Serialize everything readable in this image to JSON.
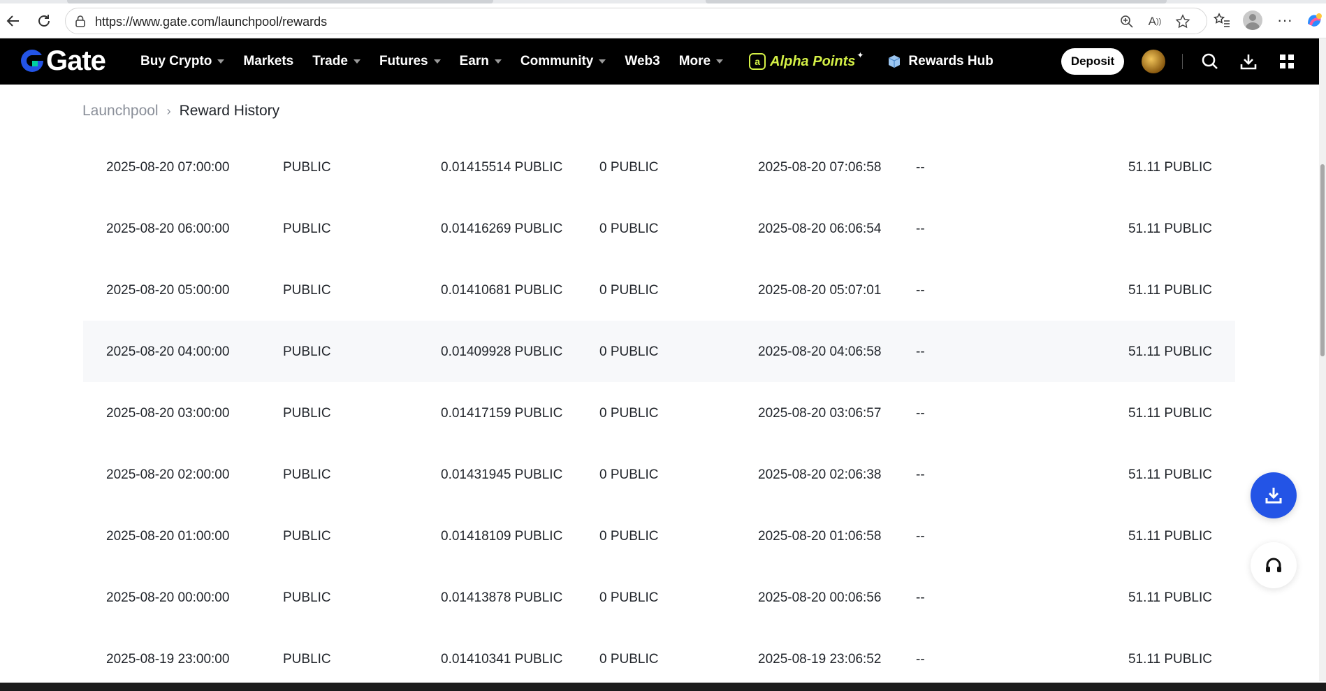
{
  "browser": {
    "url": "https://www.gate.com/launchpool/rewards",
    "icons": [
      "back-icon",
      "reload-icon",
      "lock-icon",
      "zoom-icon",
      "read-aloud-icon",
      "favorite-star-icon",
      "favorites-list-icon",
      "profile-icon",
      "more-icon",
      "copilot-icon"
    ]
  },
  "nav": {
    "logo_text": "Gate",
    "menu": [
      {
        "label": "Buy Crypto",
        "dropdown": true
      },
      {
        "label": "Markets",
        "dropdown": false
      },
      {
        "label": "Trade",
        "dropdown": true
      },
      {
        "label": "Futures",
        "dropdown": true
      },
      {
        "label": "Earn",
        "dropdown": true
      },
      {
        "label": "Community",
        "dropdown": true
      },
      {
        "label": "Web3",
        "dropdown": false
      },
      {
        "label": "More",
        "dropdown": true
      }
    ],
    "alpha_points": "Alpha Points",
    "rewards_hub": "Rewards Hub",
    "deposit": "Deposit",
    "colors": {
      "accent_lime": "#d4f046",
      "brand_blue": "#2354e6"
    }
  },
  "breadcrumb": {
    "parent": "Launchpool",
    "current": "Reward History"
  },
  "table": {
    "rows": [
      [
        "2025-08-20 07:00:00",
        "PUBLIC",
        "0.01415514 PUBLIC",
        "0 PUBLIC",
        "2025-08-20 07:06:58",
        "--",
        "51.11 PUBLIC"
      ],
      [
        "2025-08-20 06:00:00",
        "PUBLIC",
        "0.01416269 PUBLIC",
        "0 PUBLIC",
        "2025-08-20 06:06:54",
        "--",
        "51.11 PUBLIC"
      ],
      [
        "2025-08-20 05:00:00",
        "PUBLIC",
        "0.01410681 PUBLIC",
        "0 PUBLIC",
        "2025-08-20 05:07:01",
        "--",
        "51.11 PUBLIC"
      ],
      [
        "2025-08-20 04:00:00",
        "PUBLIC",
        "0.01409928 PUBLIC",
        "0 PUBLIC",
        "2025-08-20 04:06:58",
        "--",
        "51.11 PUBLIC"
      ],
      [
        "2025-08-20 03:00:00",
        "PUBLIC",
        "0.01417159 PUBLIC",
        "0 PUBLIC",
        "2025-08-20 03:06:57",
        "--",
        "51.11 PUBLIC"
      ],
      [
        "2025-08-20 02:00:00",
        "PUBLIC",
        "0.01431945 PUBLIC",
        "0 PUBLIC",
        "2025-08-20 02:06:38",
        "--",
        "51.11 PUBLIC"
      ],
      [
        "2025-08-20 01:00:00",
        "PUBLIC",
        "0.01418109 PUBLIC",
        "0 PUBLIC",
        "2025-08-20 01:06:58",
        "--",
        "51.11 PUBLIC"
      ],
      [
        "2025-08-20 00:00:00",
        "PUBLIC",
        "0.01413878 PUBLIC",
        "0 PUBLIC",
        "2025-08-20 00:06:56",
        "--",
        "51.11 PUBLIC"
      ],
      [
        "2025-08-19 23:00:00",
        "PUBLIC",
        "0.01410341 PUBLIC",
        "0 PUBLIC",
        "2025-08-19 23:06:52",
        "--",
        "51.11 PUBLIC"
      ]
    ],
    "highlighted_row": 3
  }
}
